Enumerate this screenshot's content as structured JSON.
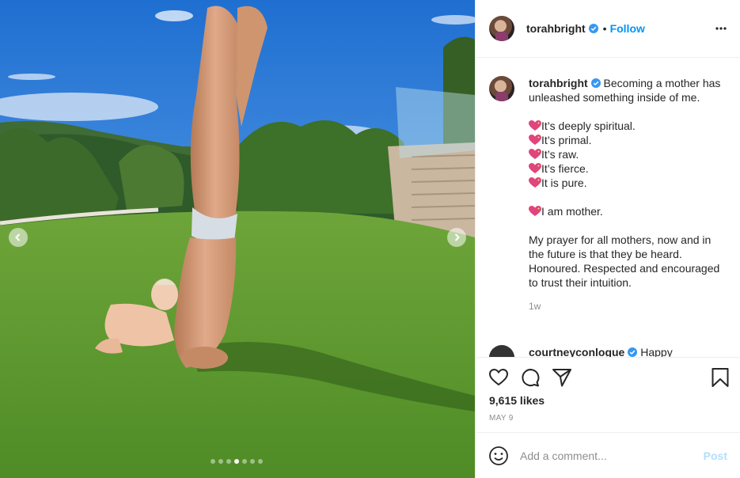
{
  "header": {
    "username": "torahbright",
    "separator": "•",
    "follow_label": "Follow",
    "verified_icon": "verified-badge-icon",
    "more_icon": "more-options-icon"
  },
  "caption": {
    "username": "torahbright",
    "lines": [
      "Becoming a mother has unleashed something inside of me.",
      "",
      "It’s deeply spiritual.",
      "It’s primal.",
      "It’s raw.",
      "It’s fierce.",
      "It is pure.",
      "",
      "I am mother.",
      "",
      "My prayer for all mothers, now and in the future is that they be heard. Honoured. Respected and encouraged to trust their intuition."
    ],
    "time_ago": "1w"
  },
  "next_comment": {
    "username": "courtneyconlogue",
    "text": "Happy"
  },
  "actions": {
    "likes": "9,615 likes",
    "date": "MAY 9",
    "icons": [
      "heart-icon",
      "comment-icon",
      "share-icon",
      "bookmark-icon"
    ]
  },
  "add_comment": {
    "placeholder": "Add a comment...",
    "post_label": "Post"
  },
  "carousel": {
    "dot_count": 7,
    "active_index": 3
  },
  "colors": {
    "accent": "#0095f6",
    "post_disabled": "#b2dffc",
    "muted": "#8e8e8e",
    "heart_emoji": "#e0457b"
  }
}
